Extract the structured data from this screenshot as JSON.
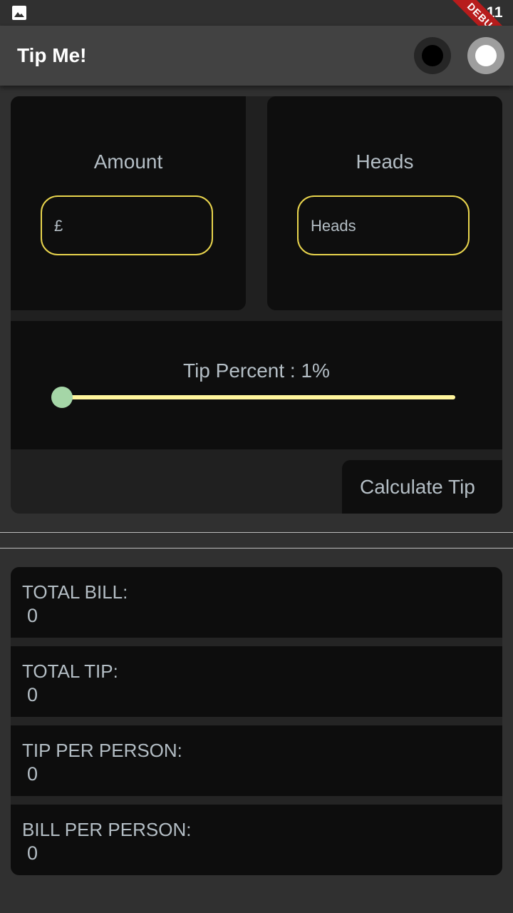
{
  "status_bar": {
    "time": "3:11",
    "debug_label": "DEBUG",
    "icon": "gallery-icon"
  },
  "app_bar": {
    "title": "Tip Me!",
    "dark_theme_icon": "dark-mode-icon",
    "light_theme_icon": "light-mode-icon"
  },
  "amount": {
    "label": "Amount",
    "placeholder": "£"
  },
  "heads": {
    "label": "Heads",
    "placeholder": "Heads"
  },
  "tip": {
    "label": "Tip Percent : 1%",
    "percent": 1,
    "slider_fraction": 0.0
  },
  "calculate_button": {
    "label": "Calculate Tip"
  },
  "results": [
    {
      "label": "TOTAL BILL:",
      "value": "0"
    },
    {
      "label": "TOTAL TIP:",
      "value": "0"
    },
    {
      "label": "TIP PER PERSON:",
      "value": "0"
    },
    {
      "label": "BILL PER PERSON:",
      "value": "0"
    }
  ],
  "colors": {
    "background": "#303030",
    "app_bar": "#424242",
    "card": "#0e0e0e",
    "field_border": "#e8d44d",
    "slider_track": "#fff59d",
    "slider_thumb": "#a5d6a7",
    "debug_ribbon": "#b71c1c"
  }
}
